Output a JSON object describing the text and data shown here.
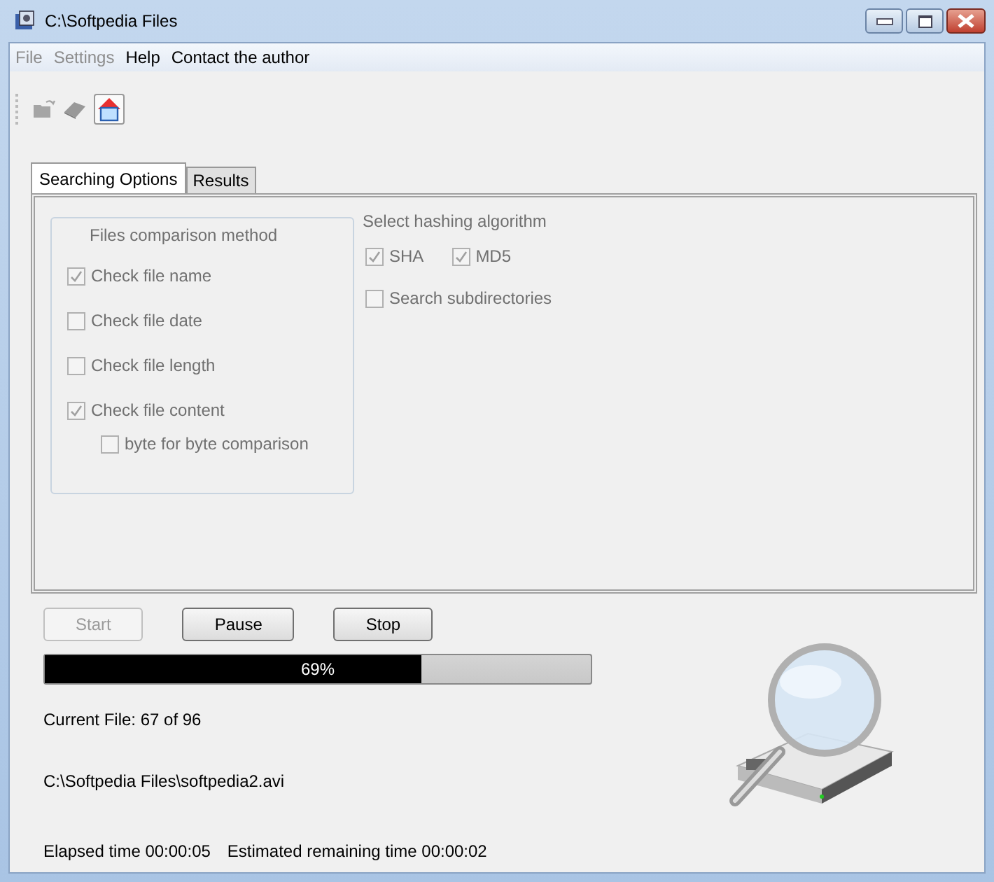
{
  "window": {
    "title": "C:\\Softpedia Files"
  },
  "menu": [
    {
      "label": "File",
      "disabled": true
    },
    {
      "label": "Settings",
      "disabled": true
    },
    {
      "label": "Help",
      "disabled": false
    },
    {
      "label": "Contact the author",
      "disabled": false
    }
  ],
  "toolbar": [
    {
      "kind": "open",
      "disabled": true
    },
    {
      "kind": "eraser",
      "disabled": true
    },
    {
      "kind": "home",
      "disabled": false
    }
  ],
  "tabs": [
    {
      "label": "Searching Options",
      "selected": true
    },
    {
      "label": "Results",
      "selected": false
    }
  ],
  "comparison": {
    "title": "Files comparison method",
    "options": [
      {
        "label": "Check file name",
        "checked": true,
        "disabled": true,
        "nested": false
      },
      {
        "label": "Check file date",
        "checked": false,
        "disabled": true,
        "nested": false
      },
      {
        "label": "Check file length",
        "checked": false,
        "disabled": true,
        "nested": false
      },
      {
        "label": "Check file content",
        "checked": true,
        "disabled": true,
        "nested": false
      },
      {
        "label": "byte for byte comparison",
        "checked": false,
        "disabled": true,
        "nested": true
      }
    ]
  },
  "hashing": {
    "title": "Select hashing algorithm",
    "algorithms": [
      {
        "label": "SHA",
        "checked": true,
        "disabled": true
      },
      {
        "label": "MD5",
        "checked": true,
        "disabled": true
      }
    ],
    "subdirectories": {
      "label": "Search subdirectories",
      "checked": false,
      "disabled": true
    }
  },
  "buttons": [
    {
      "label": "Start",
      "disabled": true
    },
    {
      "label": "Pause",
      "disabled": false
    },
    {
      "label": "Stop",
      "disabled": false
    }
  ],
  "progress": {
    "level": 0.69,
    "text": "69%"
  },
  "current_file": "Current File: 67 of 96",
  "path": "C:\\Softpedia Files\\softpedia2.avi",
  "elapsed": "Elapsed time 00:00:05",
  "remaining": "Estimated remaining time 00:00:02"
}
